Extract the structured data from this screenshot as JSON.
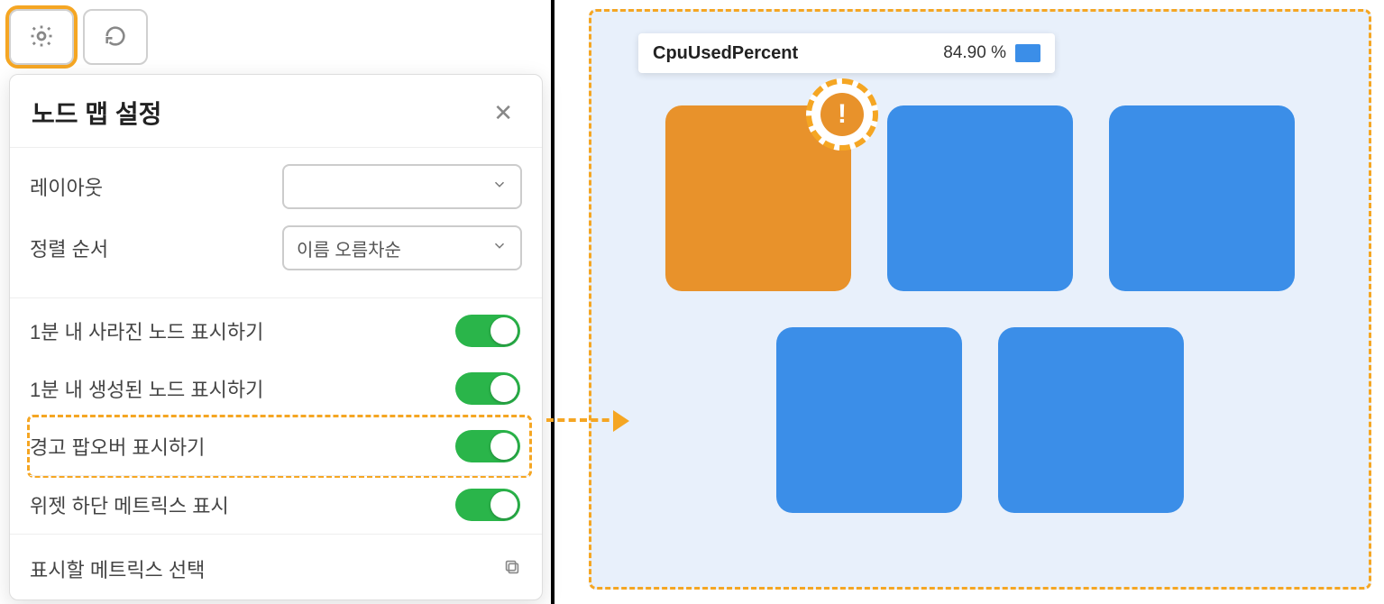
{
  "toolbar": {
    "gear_name": "gear-icon",
    "refresh_name": "refresh-icon"
  },
  "settings": {
    "title": "노드 맵 설정",
    "close": "✕",
    "layout": {
      "label": "레이아웃",
      "value": ""
    },
    "sort": {
      "label": "정렬 순서",
      "value": "이름 오름차순"
    },
    "toggles": [
      {
        "label": "1분 내 사라진 노드 표시하기",
        "on": true,
        "highlight": false
      },
      {
        "label": "1분 내 생성된 노드 표시하기",
        "on": true,
        "highlight": false
      },
      {
        "label": "경고 팝오버 표시하기",
        "on": true,
        "highlight": true
      },
      {
        "label": "위젯 하단 메트릭스 표시",
        "on": true,
        "highlight": false
      }
    ],
    "metric_select_label": "표시할 메트릭스 선택"
  },
  "nodemap": {
    "legend": {
      "title": "CpuUsedPercent",
      "value": "84.90 %",
      "swatch_color": "#3b8ee8"
    },
    "nodes": [
      {
        "status": "warning",
        "highlight_badge": true
      },
      {
        "status": "normal"
      },
      {
        "status": "normal"
      },
      {
        "status": "normal"
      },
      {
        "status": "normal"
      }
    ],
    "warning_glyph": "!",
    "colors": {
      "normal": "#3b8ee8",
      "warning": "#e8922b",
      "panel_bg": "#e8f0fb",
      "accent": "#f5a623"
    }
  }
}
